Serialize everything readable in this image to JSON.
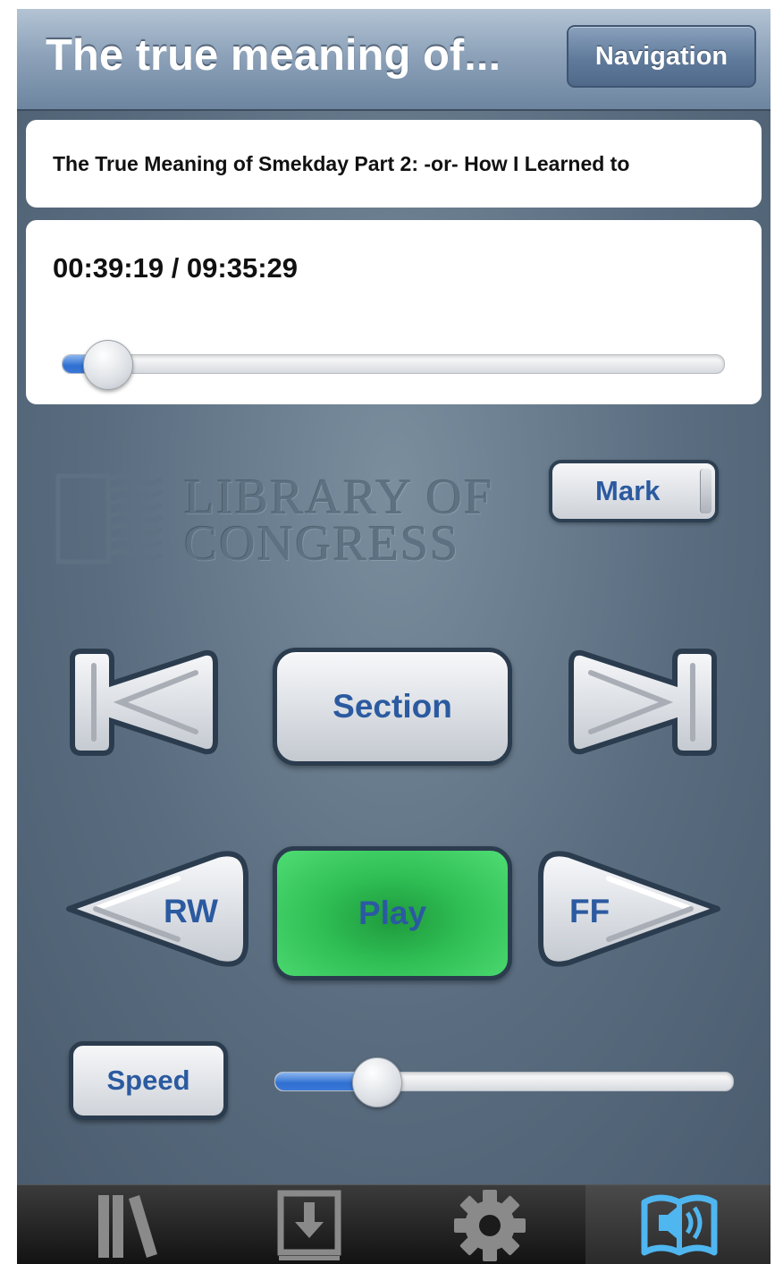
{
  "navbar": {
    "title": "The true meaning of...",
    "navigation_label": "Navigation"
  },
  "book": {
    "title": "The True Meaning of Smekday Part 2: -or- How I Learned to"
  },
  "playback": {
    "time": "00:39:19 / 09:35:29",
    "position_fraction": 0.068
  },
  "logo": {
    "line1": "LIBRARY OF",
    "line2": "CONGRESS"
  },
  "controls": {
    "mark_label": "Mark",
    "section_label": "Section",
    "previous_icon": "skip-back-icon",
    "next_icon": "skip-forward-icon",
    "rw_label": "RW",
    "play_label": "Play",
    "ff_label": "FF",
    "speed_label": "Speed",
    "speed_fraction": 0.22
  },
  "colors": {
    "accent_blue": "#2b5aa0",
    "play_green": "#2fbf55"
  },
  "tabs": [
    {
      "icon": "bookshelf-icon",
      "active": false
    },
    {
      "icon": "download-icon",
      "active": false
    },
    {
      "icon": "gear-icon",
      "active": false
    },
    {
      "icon": "open-book-audio-icon",
      "active": true
    }
  ]
}
